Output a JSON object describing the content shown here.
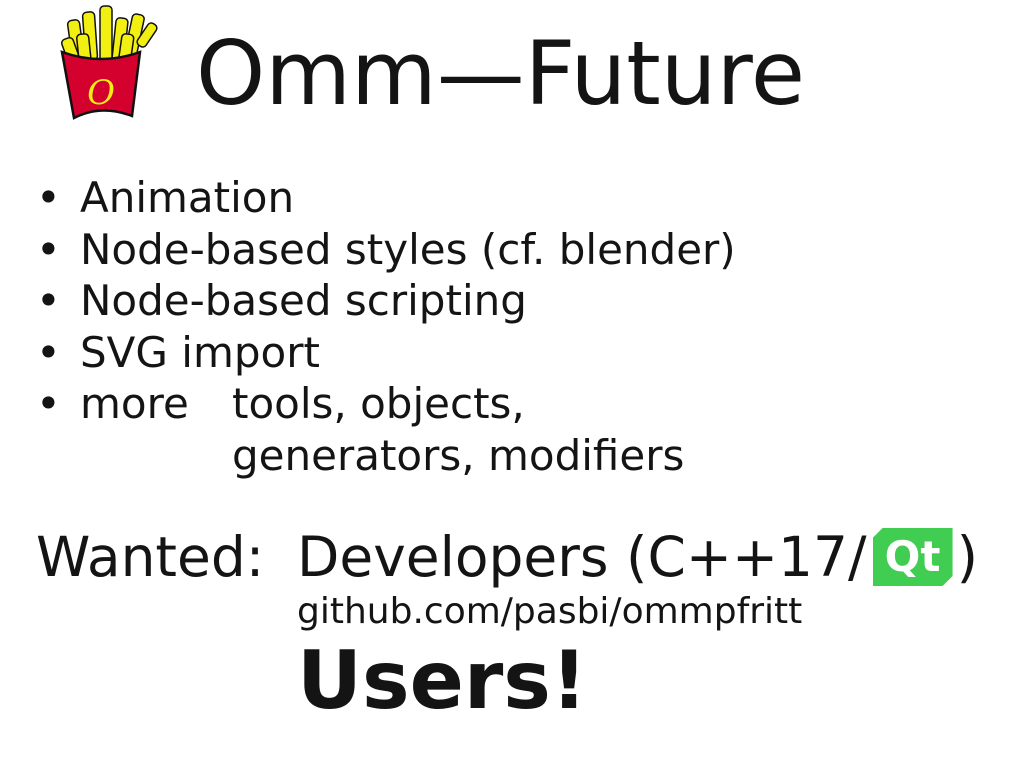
{
  "slide": {
    "title": "Omm—Future",
    "logo": {
      "icon": "french-fries-icon",
      "letter": "O",
      "colors": {
        "box": "#d4002d",
        "fries": "#f2ef12",
        "letter": "#f2ef12",
        "outline": "#111111"
      }
    },
    "bullets": [
      "Animation",
      "Node-based styles (cf. blender)",
      "Node-based scripting",
      "SVG import"
    ],
    "more": {
      "label": "more",
      "values": [
        "tools, objects,",
        "generators, modifiers"
      ]
    },
    "wanted": {
      "label": "Wanted:",
      "developers_prefix": "Developers (C++17/",
      "qt_label": "Qt",
      "developers_suffix": ")",
      "link": "github.com/pasbi/ommpfritt",
      "users": "Users!"
    },
    "colors": {
      "text": "#141414",
      "qt_green": "#41cd52",
      "background": "#ffffff"
    }
  }
}
